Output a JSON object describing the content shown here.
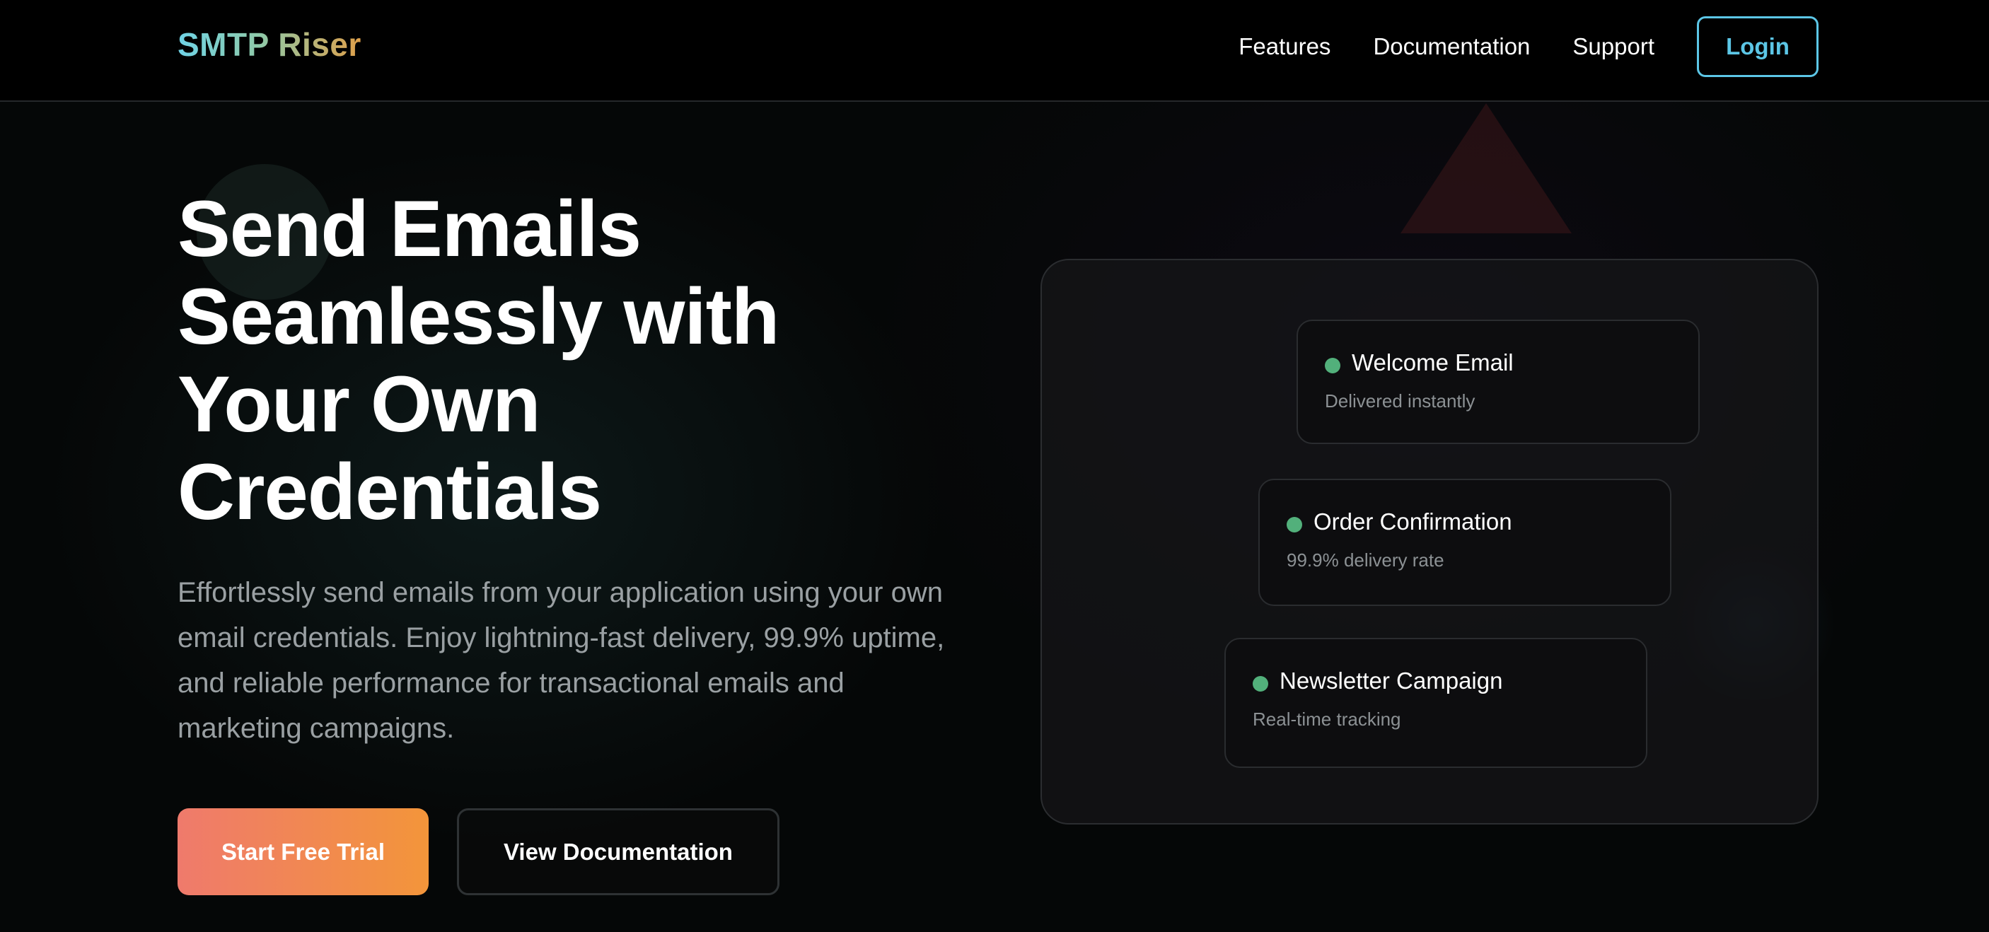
{
  "header": {
    "logo": "SMTP Riser",
    "nav": {
      "features": "Features",
      "documentation": "Documentation",
      "support": "Support",
      "login": "Login"
    }
  },
  "hero": {
    "title": "Send Emails Seamlessly with Your Own Credentials",
    "subtitle": "Effortlessly send emails from your application using your own email credentials. Enjoy lightning-fast delivery, 99.9% uptime, and reliable performance for transactional emails and marketing campaigns.",
    "primary_cta": "Start Free Trial",
    "secondary_cta": "View Documentation"
  },
  "panel": {
    "cards": [
      {
        "title": "Welcome Email",
        "subtitle": "Delivered instantly",
        "status_color": "#52b07b"
      },
      {
        "title": "Order Confirmation",
        "subtitle": "99.9% delivery rate",
        "status_color": "#52b07b"
      },
      {
        "title": "Newsletter Campaign",
        "subtitle": "Real-time tracking",
        "status_color": "#52b07b"
      }
    ]
  },
  "colors": {
    "accent_login": "#5cc6e6",
    "cta_gradient_start": "#ef7a6c",
    "cta_gradient_end": "#f3953a",
    "background": "#050707"
  }
}
